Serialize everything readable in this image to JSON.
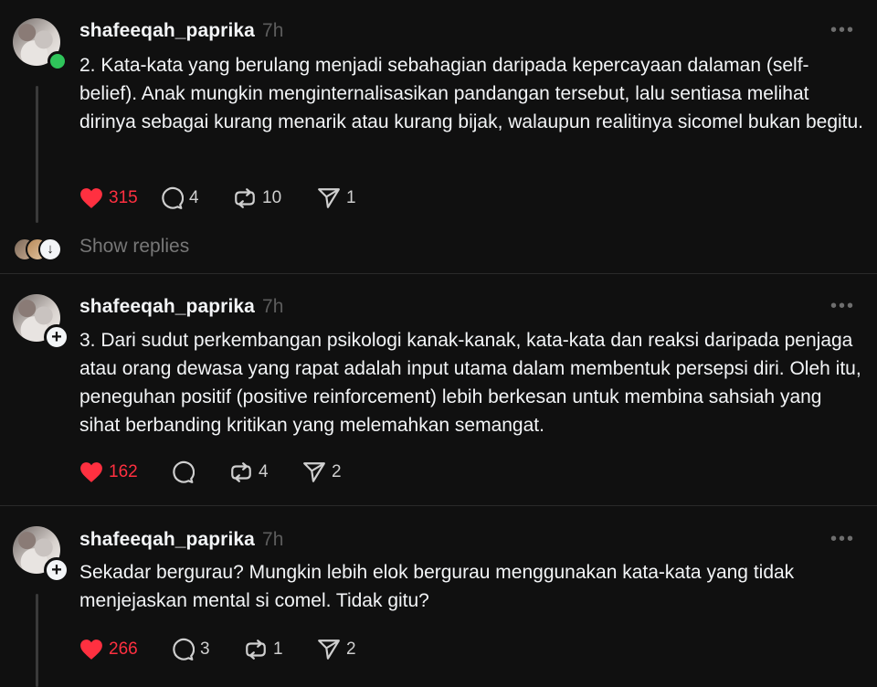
{
  "posts": [
    {
      "username": "shafeeqah_paprika",
      "time": "7h",
      "more": "•••",
      "text": "2. Kata-kata yang berulang menjadi sebahagian daripada kepercayaan dalaman (self-belief). Anak mungkin menginternalisasikan pandangan tersebut, lalu sentiasa melihat dirinya sebagai kurang menarik atau kurang bijak, walaupun realitinya sicomel bukan begitu.",
      "likes": "315",
      "replies": "4",
      "reposts": "10",
      "shares": "1"
    },
    {
      "username": "shafeeqah_paprika",
      "time": "7h",
      "more": "•••",
      "text": "3. Dari sudut perkembangan psikologi kanak-kanak, kata-kata dan reaksi daripada penjaga atau orang dewasa yang rapat adalah input utama dalam membentuk persepsi diri. Oleh itu, peneguhan positif (positive reinforcement) lebih berkesan untuk membina sahsiah yang sihat berbanding kritikan yang melemahkan semangat.",
      "likes": "162",
      "replies": "",
      "reposts": "4",
      "shares": "2"
    },
    {
      "username": "shafeeqah_paprika",
      "time": "7h",
      "more": "•••",
      "text": "Sekadar bergurau? Mungkin lebih elok bergurau menggunakan kata-kata yang tidak menjejaskan mental si comel. Tidak gitu?",
      "likes": "266",
      "replies": "3",
      "reposts": "1",
      "shares": "2"
    }
  ],
  "thread": {
    "show_replies": "Show replies"
  },
  "colors": {
    "background": "#101010",
    "like": "#ff3040",
    "online": "#2fc45a",
    "muted": "#777777"
  }
}
